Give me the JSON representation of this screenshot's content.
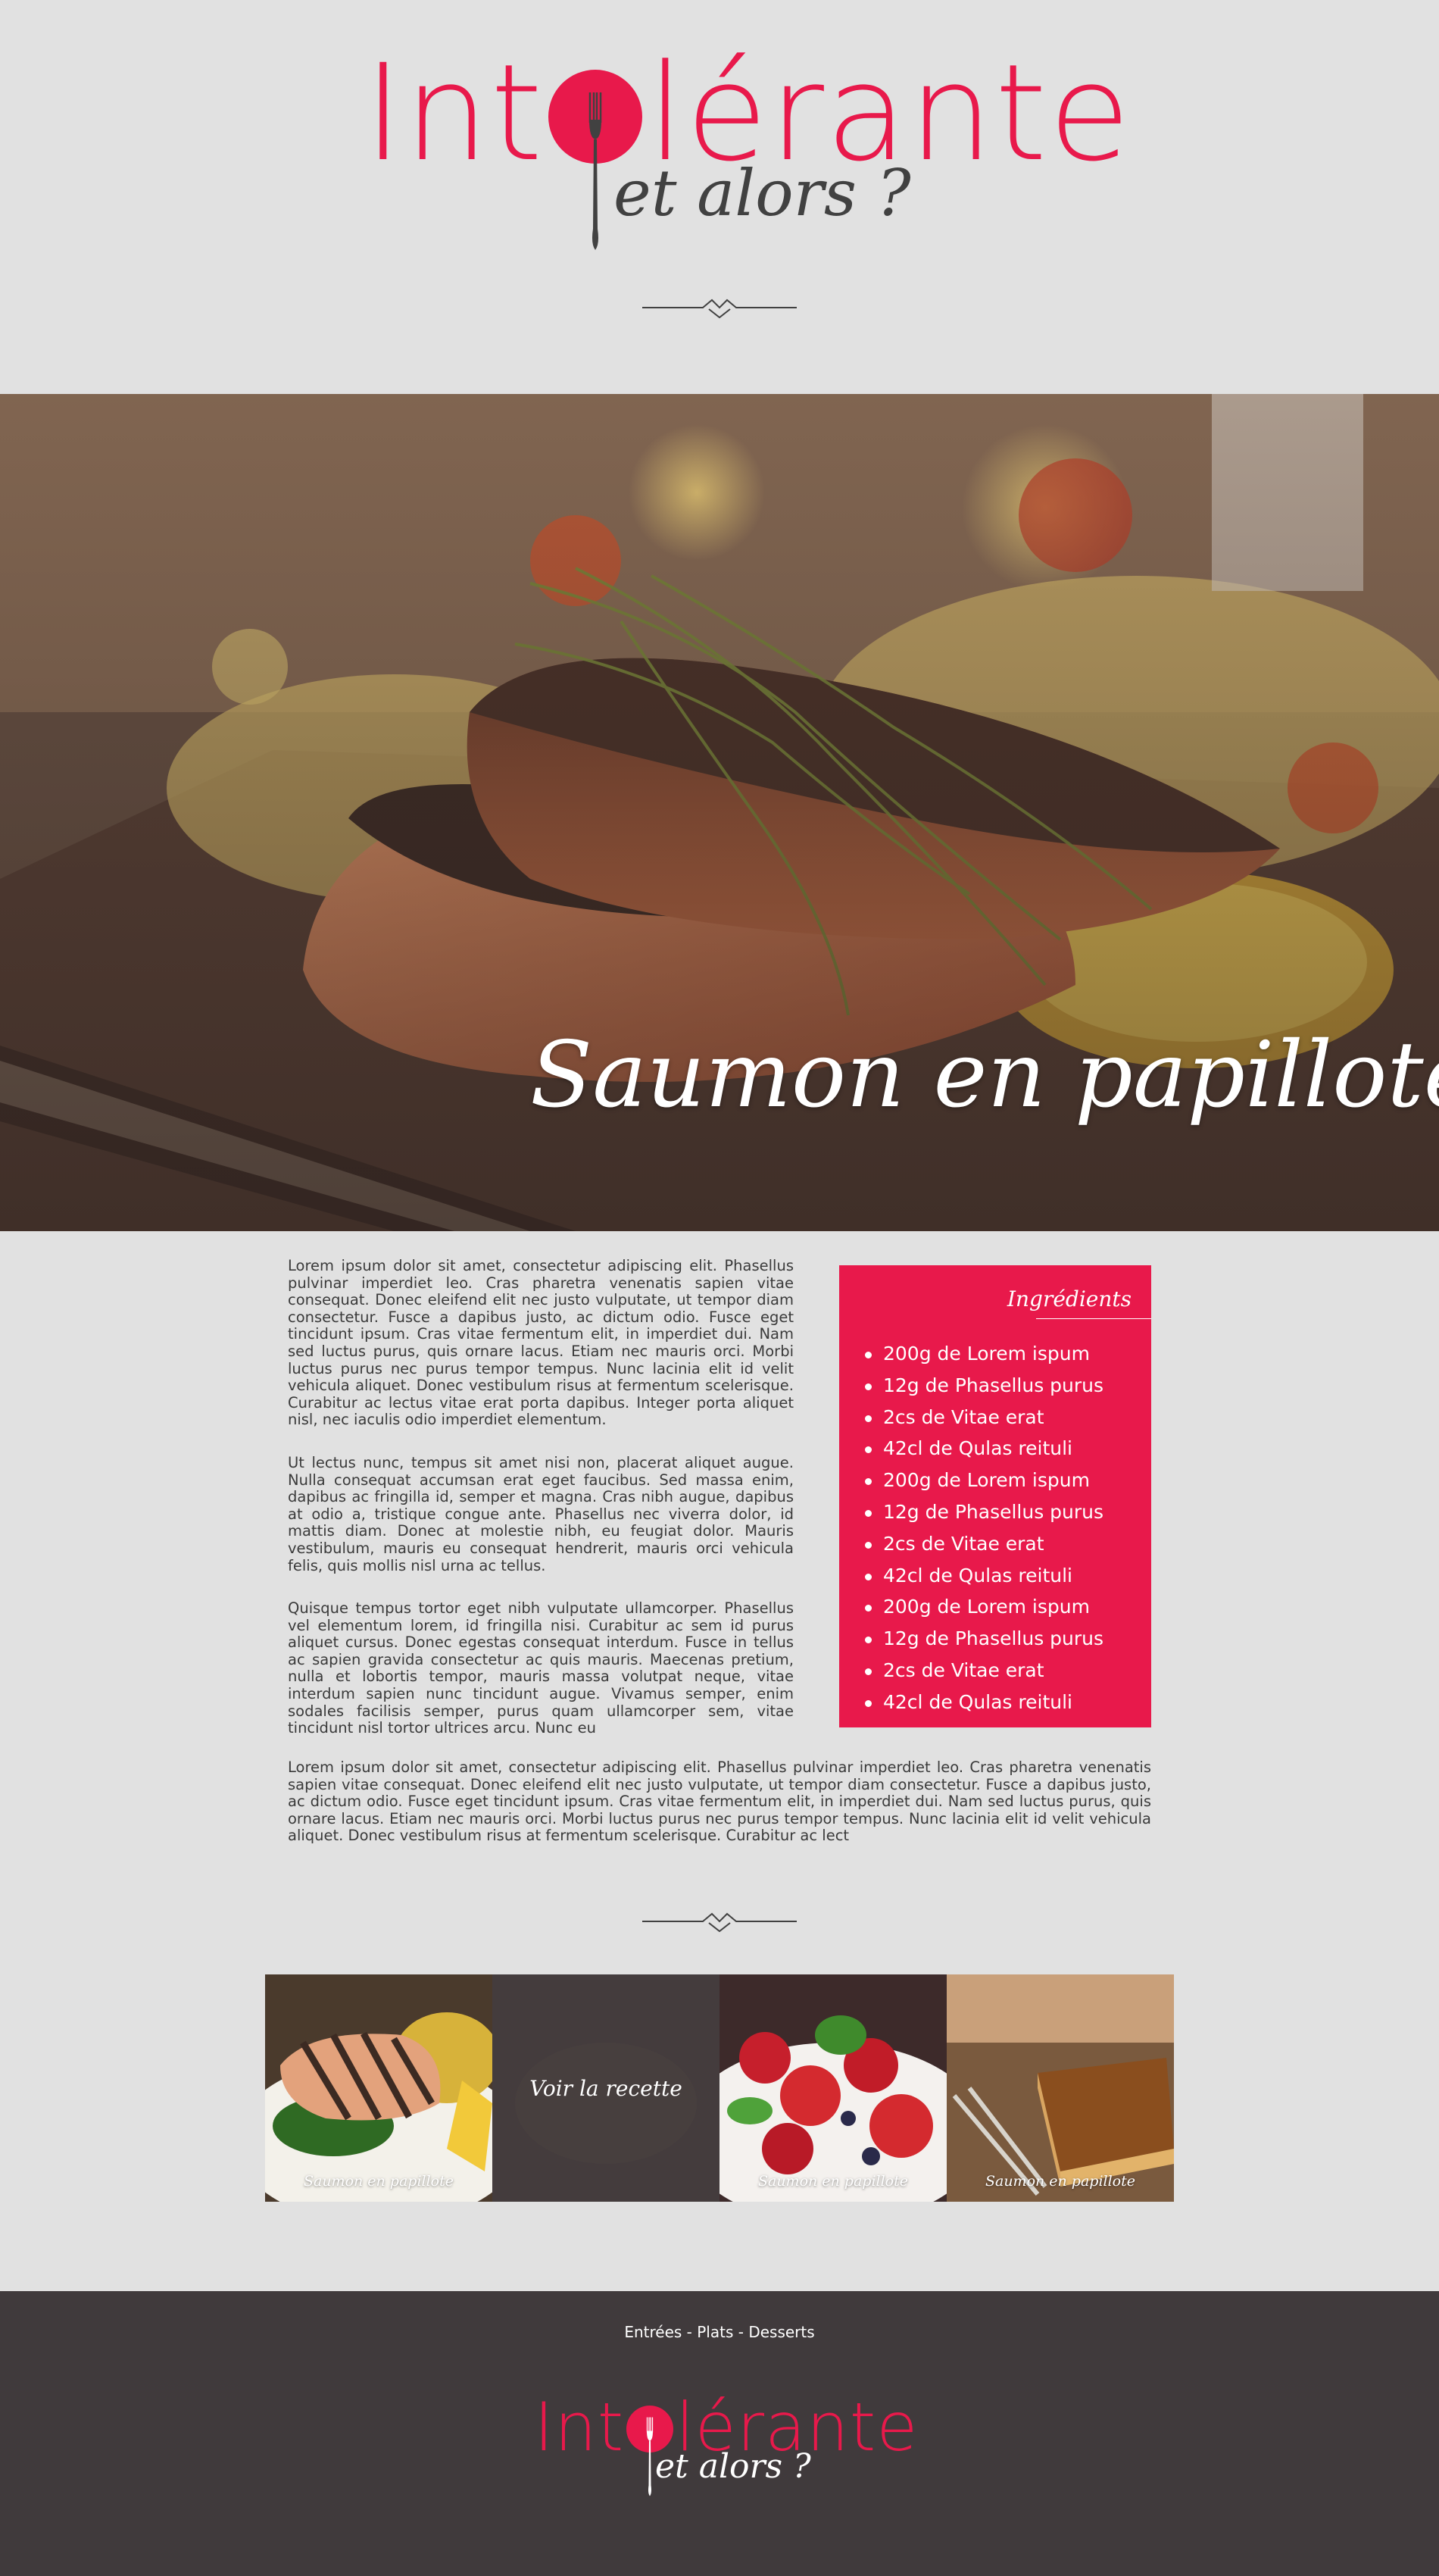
{
  "brand": {
    "logo_main": "Intolérante",
    "logo_prefix": "Int",
    "logo_suffix": "lérante",
    "logo_sub": "et alors ?",
    "accent_color": "#e8194b",
    "dark_color": "#403a3c",
    "background_color": "#e1e1e1"
  },
  "hero": {
    "title": "Saumon en papillote"
  },
  "article": {
    "paragraphs": [
      "Lorem ipsum dolor sit amet, consectetur adipiscing elit. Phasellus pulvinar imperdiet leo. Cras pharetra venenatis sapien vitae consequat. Donec eleifend elit nec justo vulputate, ut tempor diam consectetur. Fusce a dapibus justo, ac dictum odio. Fusce eget tincidunt ipsum. Cras vitae fermentum elit, in imperdiet dui. Nam sed luctus purus, quis ornare lacus. Etiam nec mauris orci. Morbi luctus purus nec purus tempor tempus. Nunc lacinia elit id velit vehicula aliquet. Donec vestibulum risus at fermentum scelerisque. Curabitur ac lectus vitae erat porta dapibus. Integer porta aliquet nisl, nec iaculis odio imperdiet elementum.",
      "Ut lectus nunc, tempus sit amet nisi non, placerat aliquet augue. Nulla consequat accumsan erat eget faucibus. Sed massa enim, dapibus ac fringilla id, semper et magna. Cras nibh augue, dapibus at odio a, tristique congue ante. Phasellus nec viverra dolor, id mattis diam. Donec at molestie nibh, eu feugiat dolor. Mauris vestibulum, mauris eu consequat hendrerit, mauris orci vehicula felis, quis mollis nisl urna ac tellus.",
      "Quisque tempus tortor eget nibh vulputate ullamcorper. Phasellus vel elementum lorem, id fringilla nisi. Curabitur ac sem id purus aliquet cursus. Donec egestas consequat interdum. Fusce in tellus ac sapien gravida consectetur ac quis mauris. Maecenas pretium, nulla et lobortis tempor, mauris massa volutpat neque, vitae interdum sapien nunc tincidunt augue. Vivamus semper, enim sodales facilisis semper, purus quam ullamcorper sem, vitae tincidunt nisl tortor ultrices arcu. Nunc eu"
    ],
    "full_paragraph": "Lorem ipsum dolor sit amet, consectetur adipiscing elit. Phasellus pulvinar imperdiet leo. Cras pharetra venenatis sapien vitae consequat. Donec eleifend elit nec justo vulputate, ut tempor diam consectetur. Fusce a dapibus justo, ac dictum odio. Fusce eget tincidunt ipsum. Cras vitae fermentum elit, in imperdiet dui. Nam sed luctus purus, quis ornare lacus. Etiam nec mauris orci. Morbi luctus purus nec purus tempor tempus. Nunc lacinia elit id velit vehicula aliquet. Donec vestibulum risus at fermentum scelerisque. Curabitur ac lect"
  },
  "ingredients": {
    "title": "Ingrédients",
    "items": [
      "200g de Lorem ispum",
      "12g de Phasellus purus",
      "2cs de Vitae erat",
      "42cl de Qulas reituli",
      "200g de Lorem ispum",
      "12g de Phasellus purus",
      "2cs de Vitae erat",
      "42cl de Qulas reituli",
      "200g de Lorem ispum",
      "12g de Phasellus purus",
      "2cs de Vitae erat",
      "42cl de Qulas reituli"
    ]
  },
  "gallery": {
    "items": [
      {
        "caption": "Saumon en papillote"
      },
      {
        "caption": "Voir la recette"
      },
      {
        "caption": "Saumon en papillote"
      },
      {
        "caption": "Saumon en papillote"
      }
    ]
  },
  "footer": {
    "nav": [
      "Entrées",
      "Plats",
      "Desserts"
    ],
    "separator": " - "
  }
}
